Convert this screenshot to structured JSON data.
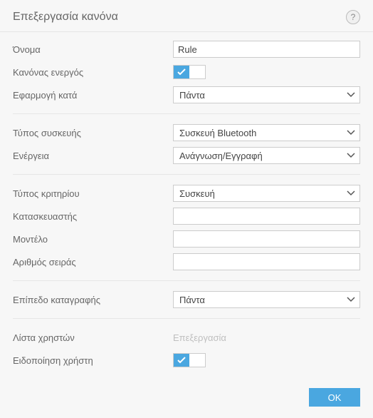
{
  "header": {
    "title": "Επεξεργασία κανόνα"
  },
  "labels": {
    "name": "Όνομα",
    "rule_enabled": "Κανόνας ενεργός",
    "apply_during": "Εφαρμογή κατά",
    "device_type": "Τύπος συσκευής",
    "action": "Ενέργεια",
    "criteria_type": "Τύπος κριτηρίου",
    "manufacturer": "Κατασκευαστής",
    "model": "Μοντέλο",
    "serial_number": "Αριθμός σειράς",
    "log_level": "Επίπεδο καταγραφής",
    "user_list": "Λίστα χρηστών",
    "user_notice": "Ειδοποίηση χρήστη"
  },
  "values": {
    "name": "Rule",
    "apply_during": "Πάντα",
    "device_type": "Συσκευή Bluetooth",
    "action": "Ανάγνωση/Εγγραφή",
    "criteria_type": "Συσκευή",
    "manufacturer": "",
    "model": "",
    "serial_number": "",
    "log_level": "Πάντα",
    "user_list_edit": "Επεξεργασία"
  },
  "footer": {
    "ok": "OK"
  }
}
